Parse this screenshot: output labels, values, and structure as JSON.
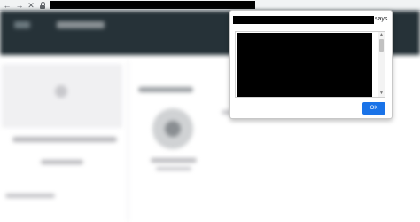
{
  "browser": {
    "back_icon": "←",
    "forward_icon": "→",
    "stop_icon": "✕",
    "url": ""
  },
  "dialog": {
    "origin": "",
    "says_label": "says",
    "message": "",
    "ok_label": "OK",
    "accent_color": "#1a73e8"
  },
  "page": {
    "topbar_color": "#263238"
  }
}
